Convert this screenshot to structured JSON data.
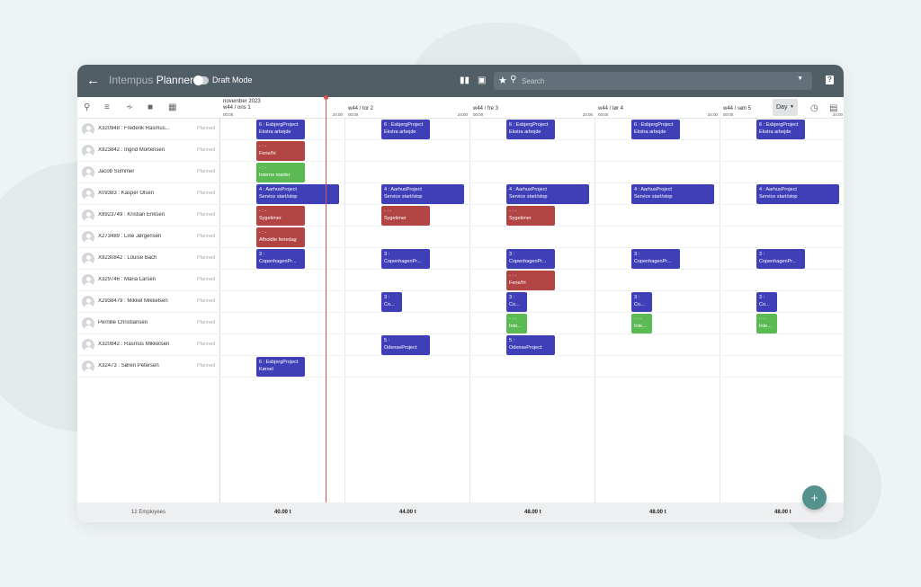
{
  "app": {
    "title_light": "Intempus",
    "title_bold": "Planner",
    "draft_label": "Draft Mode"
  },
  "search": {
    "placeholder": "Search"
  },
  "view": {
    "selected": "Day"
  },
  "days": [
    {
      "month": "november 2023",
      "week": "w44 / ons 1",
      "start": "00:00",
      "end": "24:00"
    },
    {
      "month": "",
      "week": "w44 / tor 2",
      "start": "00:00",
      "end": "24:00"
    },
    {
      "month": "",
      "week": "w44 / fre 3",
      "start": "00:00",
      "end": "24:00"
    },
    {
      "month": "",
      "week": "w44 / lør 4",
      "start": "00:00",
      "end": "24:00"
    },
    {
      "month": "",
      "week": "w44 / søn 5",
      "start": "00:00",
      "end": "24:00"
    }
  ],
  "employees": [
    {
      "name": "X320948 : Frederik Rasmus...",
      "status": "Planned"
    },
    {
      "name": "X923842 : Ingrid Mortensen",
      "status": "Planned"
    },
    {
      "name": "Jacob Summer",
      "status": "Planned"
    },
    {
      "name": "X09383 : Kasper Olsen",
      "status": "Planned"
    },
    {
      "name": "X8923749 : Kristian Eriksen",
      "status": "Planned"
    },
    {
      "name": "X273489 : Line Jørgensen",
      "status": "Planned"
    },
    {
      "name": "X9230842 : Louise Bach",
      "status": "Planned"
    },
    {
      "name": "X329746 : Maria Larsen",
      "status": "Planned"
    },
    {
      "name": "X2938479 : Mikkel Mikkelsen",
      "status": "Planned"
    },
    {
      "name": "Pernille Christiansen",
      "status": "Planned"
    },
    {
      "name": "X320842 : Rasmus Mikkelsen",
      "status": "Planned"
    },
    {
      "name": "X32473 : Søren Petersen",
      "status": "Planned"
    }
  ],
  "shifts": [
    {
      "row": 0,
      "day": 0,
      "span": "narrow",
      "color": "blue",
      "l1": "6 : EsbjergProject",
      "l2": "Ekstra arbejde"
    },
    {
      "row": 0,
      "day": 1,
      "span": "narrow",
      "color": "blue",
      "l1": "6 : EsbjergProject",
      "l2": "Ekstra arbejde"
    },
    {
      "row": 0,
      "day": 2,
      "span": "narrow",
      "color": "blue",
      "l1": "6 : EsbjergProject",
      "l2": "Ekstra arbejde"
    },
    {
      "row": 0,
      "day": 3,
      "span": "narrow",
      "color": "blue",
      "l1": "6 : EsbjergProject",
      "l2": "Ekstra arbejde"
    },
    {
      "row": 0,
      "day": 4,
      "span": "narrow",
      "color": "blue",
      "l1": "6 : EsbjergProject",
      "l2": "Ekstra arbejde"
    },
    {
      "row": 1,
      "day": 0,
      "span": "narrow",
      "color": "red",
      "l1": "- : -",
      "l2": "Ferie/fri"
    },
    {
      "row": 2,
      "day": 0,
      "span": "narrow",
      "color": "green",
      "l1": "- : -",
      "l2": "Interne møder"
    },
    {
      "row": 3,
      "day": 0,
      "span": "wide",
      "color": "blue",
      "l1": "4 : AarhusProject",
      "l2": "Service start/stop"
    },
    {
      "row": 3,
      "day": 1,
      "span": "wide",
      "color": "blue",
      "l1": "4 : AarhusProject",
      "l2": "Service start/stop"
    },
    {
      "row": 3,
      "day": 2,
      "span": "wide",
      "color": "blue",
      "l1": "4 : AarhusProject",
      "l2": "Service start/stop"
    },
    {
      "row": 3,
      "day": 3,
      "span": "wide",
      "color": "blue",
      "l1": "4 : AarhusProject",
      "l2": "Service start/stop"
    },
    {
      "row": 3,
      "day": 4,
      "span": "wide",
      "color": "blue",
      "l1": "4 : AarhusProject",
      "l2": "Service start/stop"
    },
    {
      "row": 4,
      "day": 0,
      "span": "narrow",
      "color": "red",
      "l1": "- : -",
      "l2": "Sygetimer"
    },
    {
      "row": 4,
      "day": 1,
      "span": "narrow",
      "color": "red",
      "l1": "- : -",
      "l2": "Sygetimer"
    },
    {
      "row": 4,
      "day": 2,
      "span": "narrow",
      "color": "red",
      "l1": "- : -",
      "l2": "Sygetimer"
    },
    {
      "row": 5,
      "day": 0,
      "span": "narrow",
      "color": "red",
      "l1": "- : -",
      "l2": "Afholdte feriedag"
    },
    {
      "row": 6,
      "day": 0,
      "span": "narrow",
      "color": "blue",
      "l1": "3 :",
      "l2": "CopenhagenPr..."
    },
    {
      "row": 6,
      "day": 1,
      "span": "narrow",
      "color": "blue",
      "l1": "3 :",
      "l2": "CopenhagenPr..."
    },
    {
      "row": 6,
      "day": 2,
      "span": "narrow",
      "color": "blue",
      "l1": "3 :",
      "l2": "CopenhagenPr..."
    },
    {
      "row": 6,
      "day": 3,
      "span": "narrow",
      "color": "blue",
      "l1": "3 :",
      "l2": "CopenhagenPr..."
    },
    {
      "row": 6,
      "day": 4,
      "span": "narrow",
      "color": "blue",
      "l1": "3 :",
      "l2": "CopenhagenPr..."
    },
    {
      "row": 7,
      "day": 2,
      "span": "narrow",
      "color": "red",
      "l1": "- : -",
      "l2": "Ferie/fri"
    },
    {
      "row": 8,
      "day": 1,
      "span": "tiny",
      "color": "blue",
      "l1": "3 :",
      "l2": "Co..."
    },
    {
      "row": 8,
      "day": 2,
      "span": "tiny",
      "color": "blue",
      "l1": "3 :",
      "l2": "Co..."
    },
    {
      "row": 8,
      "day": 3,
      "span": "tiny",
      "color": "blue",
      "l1": "3 :",
      "l2": "Co..."
    },
    {
      "row": 8,
      "day": 4,
      "span": "tiny",
      "color": "blue",
      "l1": "3 :",
      "l2": "Co..."
    },
    {
      "row": 9,
      "day": 2,
      "span": "tiny",
      "color": "green",
      "l1": "- : -",
      "l2": "Inte..."
    },
    {
      "row": 9,
      "day": 3,
      "span": "tiny",
      "color": "green",
      "l1": "- : -",
      "l2": "Inte..."
    },
    {
      "row": 9,
      "day": 4,
      "span": "tiny",
      "color": "green",
      "l1": "- : -",
      "l2": "Inte..."
    },
    {
      "row": 10,
      "day": 1,
      "span": "narrow",
      "color": "blue",
      "l1": "5 :",
      "l2": "OdenseProject"
    },
    {
      "row": 10,
      "day": 2,
      "span": "narrow",
      "color": "blue",
      "l1": "5 :",
      "l2": "OdenseProject"
    },
    {
      "row": 11,
      "day": 0,
      "span": "narrow",
      "color": "blue",
      "l1": "6 : EsbjergProject",
      "l2": "Kørsel"
    }
  ],
  "footer": {
    "employee_count": "12 Employees",
    "totals": [
      "40.00 t",
      "44.00 t",
      "48.00 t",
      "48.00 t",
      "48.00 t"
    ]
  },
  "colors": {
    "topbar": "#515e66",
    "blue": "#3f3fb8",
    "red": "#b24444",
    "green": "#5cba55",
    "fab": "#56928d",
    "now_line": "#e05050"
  },
  "icons": [
    "back-arrow-icon",
    "columns-icon",
    "bookmark-icon",
    "star-icon",
    "search-icon",
    "help-icon",
    "list-icon",
    "filter-icon",
    "folder-icon",
    "calendar-icon",
    "clock-icon",
    "avatar-icon",
    "add-icon"
  ]
}
